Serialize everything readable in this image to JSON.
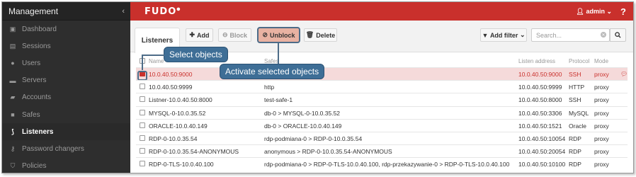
{
  "sidebar": {
    "title": "Management",
    "collapse_icon": "chevron-left-icon",
    "items": [
      {
        "label": "Dashboard",
        "icon": "dashboard-icon"
      },
      {
        "label": "Sessions",
        "icon": "film-icon"
      },
      {
        "label": "Users",
        "icon": "users-icon"
      },
      {
        "label": "Servers",
        "icon": "server-icon"
      },
      {
        "label": "Accounts",
        "icon": "book-icon"
      },
      {
        "label": "Safes",
        "icon": "safe-icon"
      },
      {
        "label": "Listeners",
        "icon": "rss-icon",
        "active": true
      },
      {
        "label": "Password changers",
        "icon": "key-icon"
      },
      {
        "label": "Policies",
        "icon": "shield-icon"
      }
    ]
  },
  "topbar": {
    "logo": "FUDO",
    "user": "admin",
    "help": "?",
    "brand_color": "#c9302c"
  },
  "toolbar": {
    "tab": "Listeners",
    "add": "Add",
    "block": "Block",
    "unblock": "Unblock",
    "delete": "Delete",
    "add_filter": "Add filter",
    "search_placeholder": "Search..."
  },
  "table": {
    "headers": [
      "Name",
      "Safes",
      "Listen address",
      "Protocol",
      "Mode"
    ],
    "rows": [
      {
        "name": "10.0.40.50:9000",
        "safe": "",
        "address": "10.0.40.50:9000",
        "protocol": "SSH",
        "mode": "proxy",
        "selected": true
      },
      {
        "name": "10.0.40.50:9999",
        "safe": "http",
        "address": "10.0.40.50:9999",
        "protocol": "HTTP",
        "mode": "proxy"
      },
      {
        "name": "Listner-10.0.40.50:8000",
        "safe": "test-safe-1",
        "address": "10.0.40.50:8000",
        "protocol": "SSH",
        "mode": "proxy"
      },
      {
        "name": "MYSQL-0-10.0.35.52",
        "safe": "db-0 > MYSQL-0-10.0.35.52",
        "address": "10.0.40.50:3306",
        "protocol": "MySQL",
        "mode": "proxy"
      },
      {
        "name": "ORACLE-10.0.40.149",
        "safe": "db-0 > ORACLE-10.0.40.149",
        "address": "10.0.40.50:1521",
        "protocol": "Oracle",
        "mode": "proxy"
      },
      {
        "name": "RDP-0-10.0.35.54",
        "safe": "rdp-podmiana-0 > RDP-0-10.0.35.54",
        "address": "10.0.40.50:10054",
        "protocol": "RDP",
        "mode": "proxy"
      },
      {
        "name": "RDP-0-10.0.35.54-ANONYMOUS",
        "safe": "anonymous > RDP-0-10.0.35.54-ANONYMOUS",
        "address": "10.0.40.50:20054",
        "protocol": "RDP",
        "mode": "proxy"
      },
      {
        "name": "RDP-0-TLS-10.0.40.100",
        "safe": "rdp-podmiana-0 > RDP-0-TLS-10.0.40.100, rdp-przekazywanie-0 > RDP-0-TLS-10.0.40.100",
        "address": "10.0.40.50:10100",
        "protocol": "RDP",
        "mode": "proxy"
      }
    ]
  },
  "callouts": {
    "select": "Select objects",
    "activate": "Activate selected objects"
  },
  "colors": {
    "callout": "#3e6e96",
    "selected_row": "#f5dada",
    "unblock_button": "#e9b2a2"
  }
}
